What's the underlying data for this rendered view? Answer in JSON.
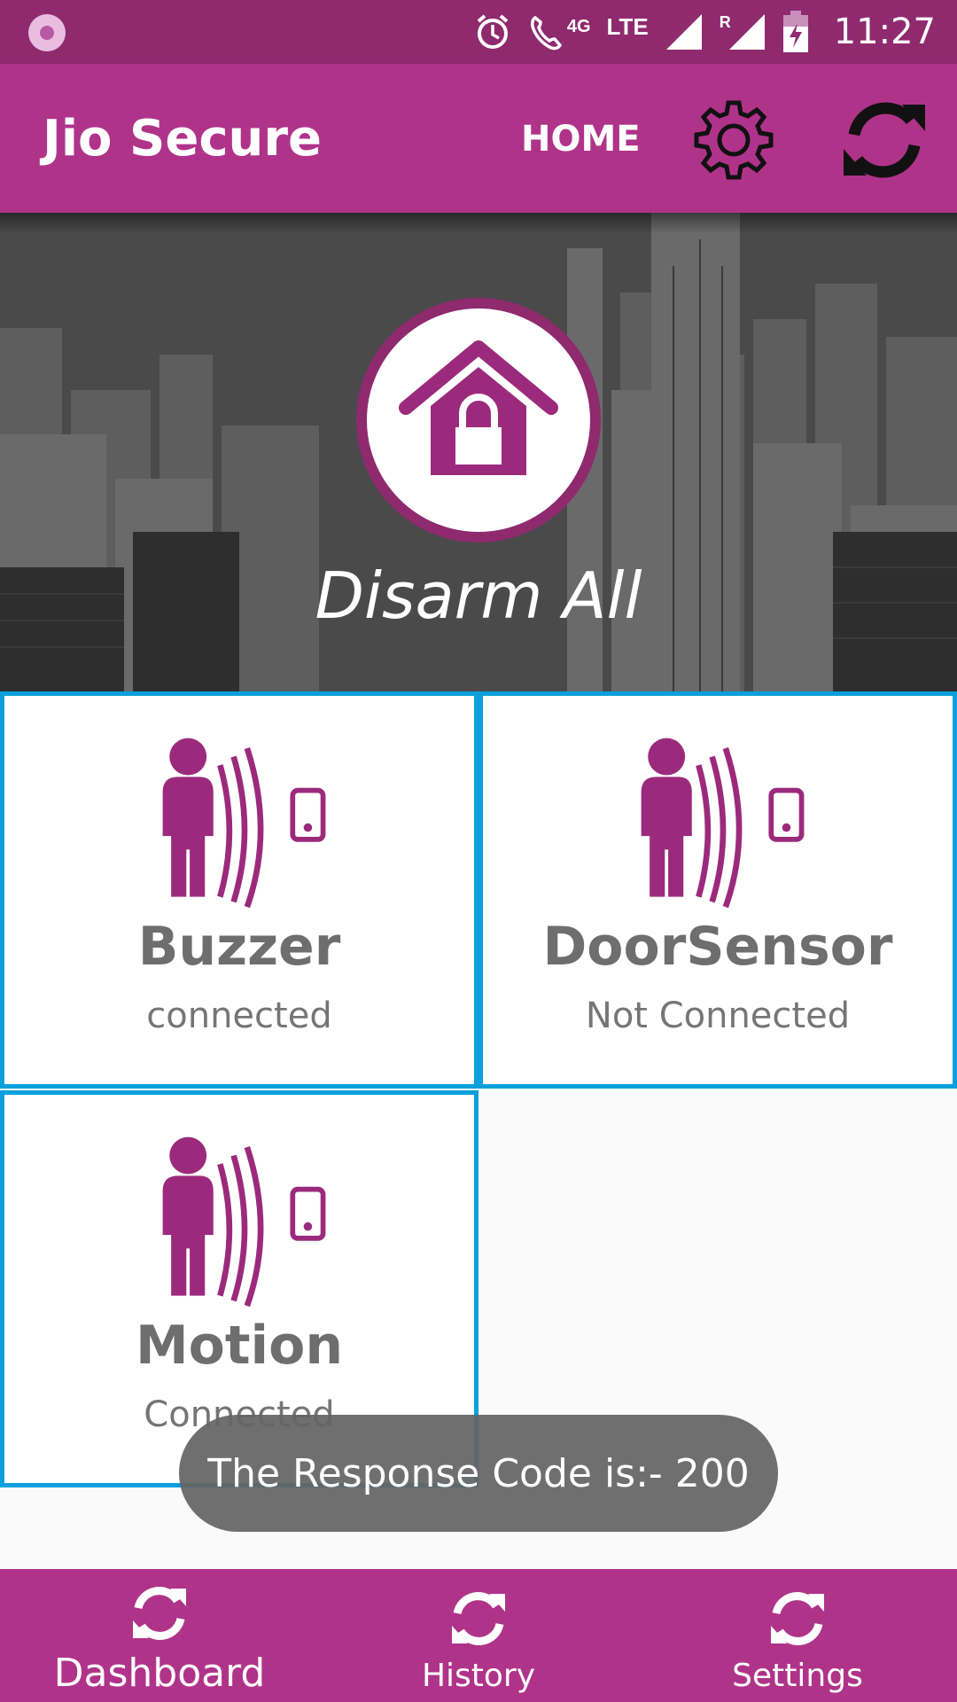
{
  "status_bar": {
    "network_4g": "4G",
    "network_lte": "LTE",
    "roaming": "R",
    "time": "11:27"
  },
  "app_bar": {
    "title": "Jio Secure",
    "home_label": "HOME",
    "settings_icon": "gear-icon",
    "refresh_icon": "refresh-icon"
  },
  "hero": {
    "disarm_icon": "home-lock-icon",
    "disarm_label": "Disarm All"
  },
  "devices": [
    {
      "name": "Buzzer",
      "status": "connected",
      "icon": "motion-sensor-icon"
    },
    {
      "name": "DoorSensor",
      "status": "Not Connected",
      "icon": "motion-sensor-icon"
    },
    {
      "name": "Motion",
      "status": "Connected",
      "icon": "motion-sensor-icon"
    }
  ],
  "toast": {
    "message": "The Response Code is:- 200"
  },
  "bottom_nav": [
    {
      "label": "Dashboard",
      "icon": "refresh-icon"
    },
    {
      "label": "History",
      "icon": "refresh-icon"
    },
    {
      "label": "Settings",
      "icon": "refresh-icon"
    }
  ],
  "colors": {
    "status_bar": "#8f2a6f",
    "primary": "#b0338a",
    "accent_icon": "#9c2a7c",
    "tile_border": "#0aa0dc"
  }
}
